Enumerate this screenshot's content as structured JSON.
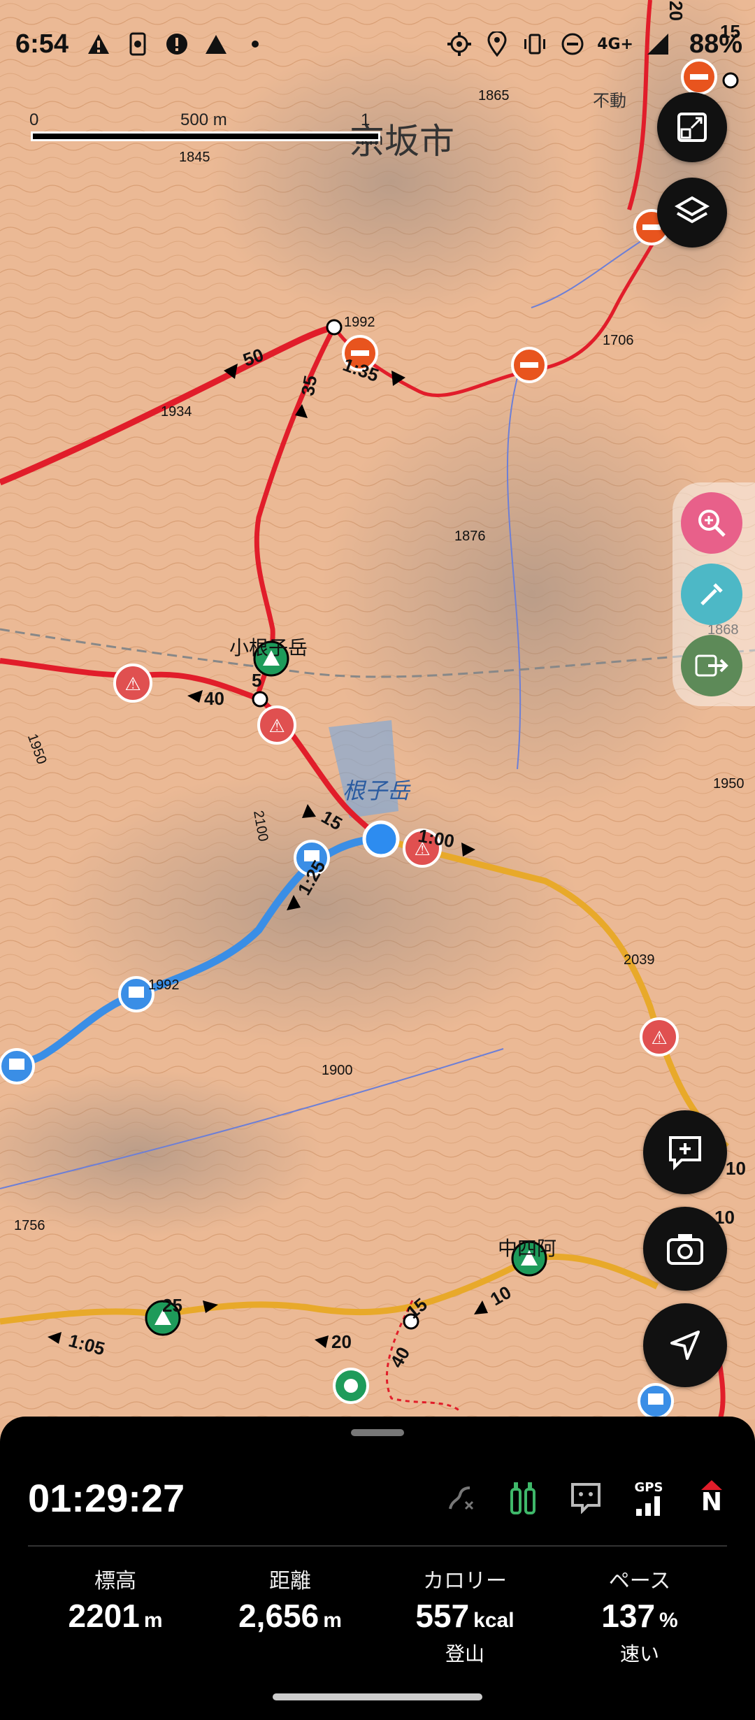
{
  "status_bar": {
    "time": "6:54",
    "battery": "88%",
    "network": "4G+"
  },
  "scale": {
    "zero": "0",
    "mid": "500 m",
    "end": "1 km"
  },
  "map_labels": {
    "city": "坂市",
    "city_partial": "京",
    "peak_main": "根子岳",
    "peak_small": "小根子岳",
    "place_naka": "中四阿",
    "temple": "不動",
    "elevations": [
      "1865",
      "1845",
      "1992",
      "1934",
      "1876",
      "1868",
      "1950",
      "1950",
      "2039",
      "2100",
      "1992",
      "1900",
      "1756",
      "1706"
    ],
    "time_markers": [
      "50",
      "35",
      "1:35",
      "40",
      "5",
      "15",
      "1:25",
      "1:00",
      "25",
      "1:05",
      "20",
      "15",
      "10",
      "40",
      "10",
      "10",
      "15",
      "20"
    ]
  },
  "colors": {
    "route_red": "#e11d2a",
    "route_yellow": "#e8a92a",
    "track_blue": "#3a8ee6",
    "contour": "#c98a5a",
    "position": "#2d8cf0"
  },
  "toolbar": {
    "icons": [
      "expand-icon",
      "layers-icon",
      "zoom-icon",
      "eyedropper-icon",
      "route-toggle-icon",
      "add-memo-icon",
      "camera-icon",
      "navigate-icon"
    ]
  },
  "panel": {
    "timer": "01:29:27",
    "gps_label": "GPS",
    "compass_label": "N",
    "stats": [
      {
        "label": "標高",
        "value": "2201",
        "unit": "m",
        "sub": ""
      },
      {
        "label": "距離",
        "value": "2,656",
        "unit": "m",
        "sub": ""
      },
      {
        "label": "カロリー",
        "value": "557",
        "unit": "kcal",
        "sub": "登山"
      },
      {
        "label": "ペース",
        "value": "137",
        "unit": "%",
        "sub": "速い"
      }
    ]
  }
}
